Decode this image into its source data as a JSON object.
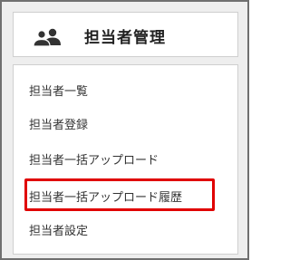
{
  "header": {
    "title": "担当者管理",
    "icon": "users-icon"
  },
  "menu": {
    "items": [
      {
        "label": "担当者一覧"
      },
      {
        "label": "担当者登録"
      },
      {
        "label": "担当者一括アップロード"
      },
      {
        "label": "担当者一括アップロード履歴",
        "highlighted": true
      },
      {
        "label": "担当者設定"
      }
    ],
    "highlight_color": "#e00000"
  }
}
